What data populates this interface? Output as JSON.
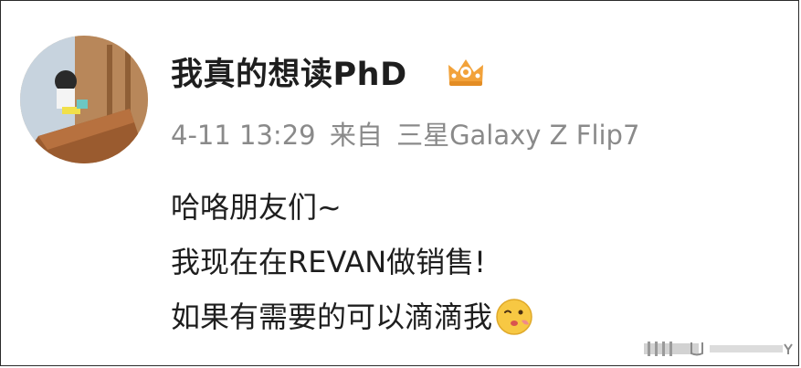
{
  "post": {
    "username": "我真的想读PhD",
    "timestamp": "4-11 13:29",
    "source_prefix": "来自",
    "device": "三星Galaxy Z Flip7",
    "lines": [
      "哈咯朋友们~",
      "我现在在REVAN做销售!",
      "如果有需要的可以滴滴我"
    ],
    "badge_icon": "crown-badge-icon",
    "emoji_icon": "wink-kiss-emoji-icon"
  },
  "colors": {
    "text": "#1e1e1e",
    "meta": "#8a8a8a",
    "badge": "#f2a23a"
  }
}
